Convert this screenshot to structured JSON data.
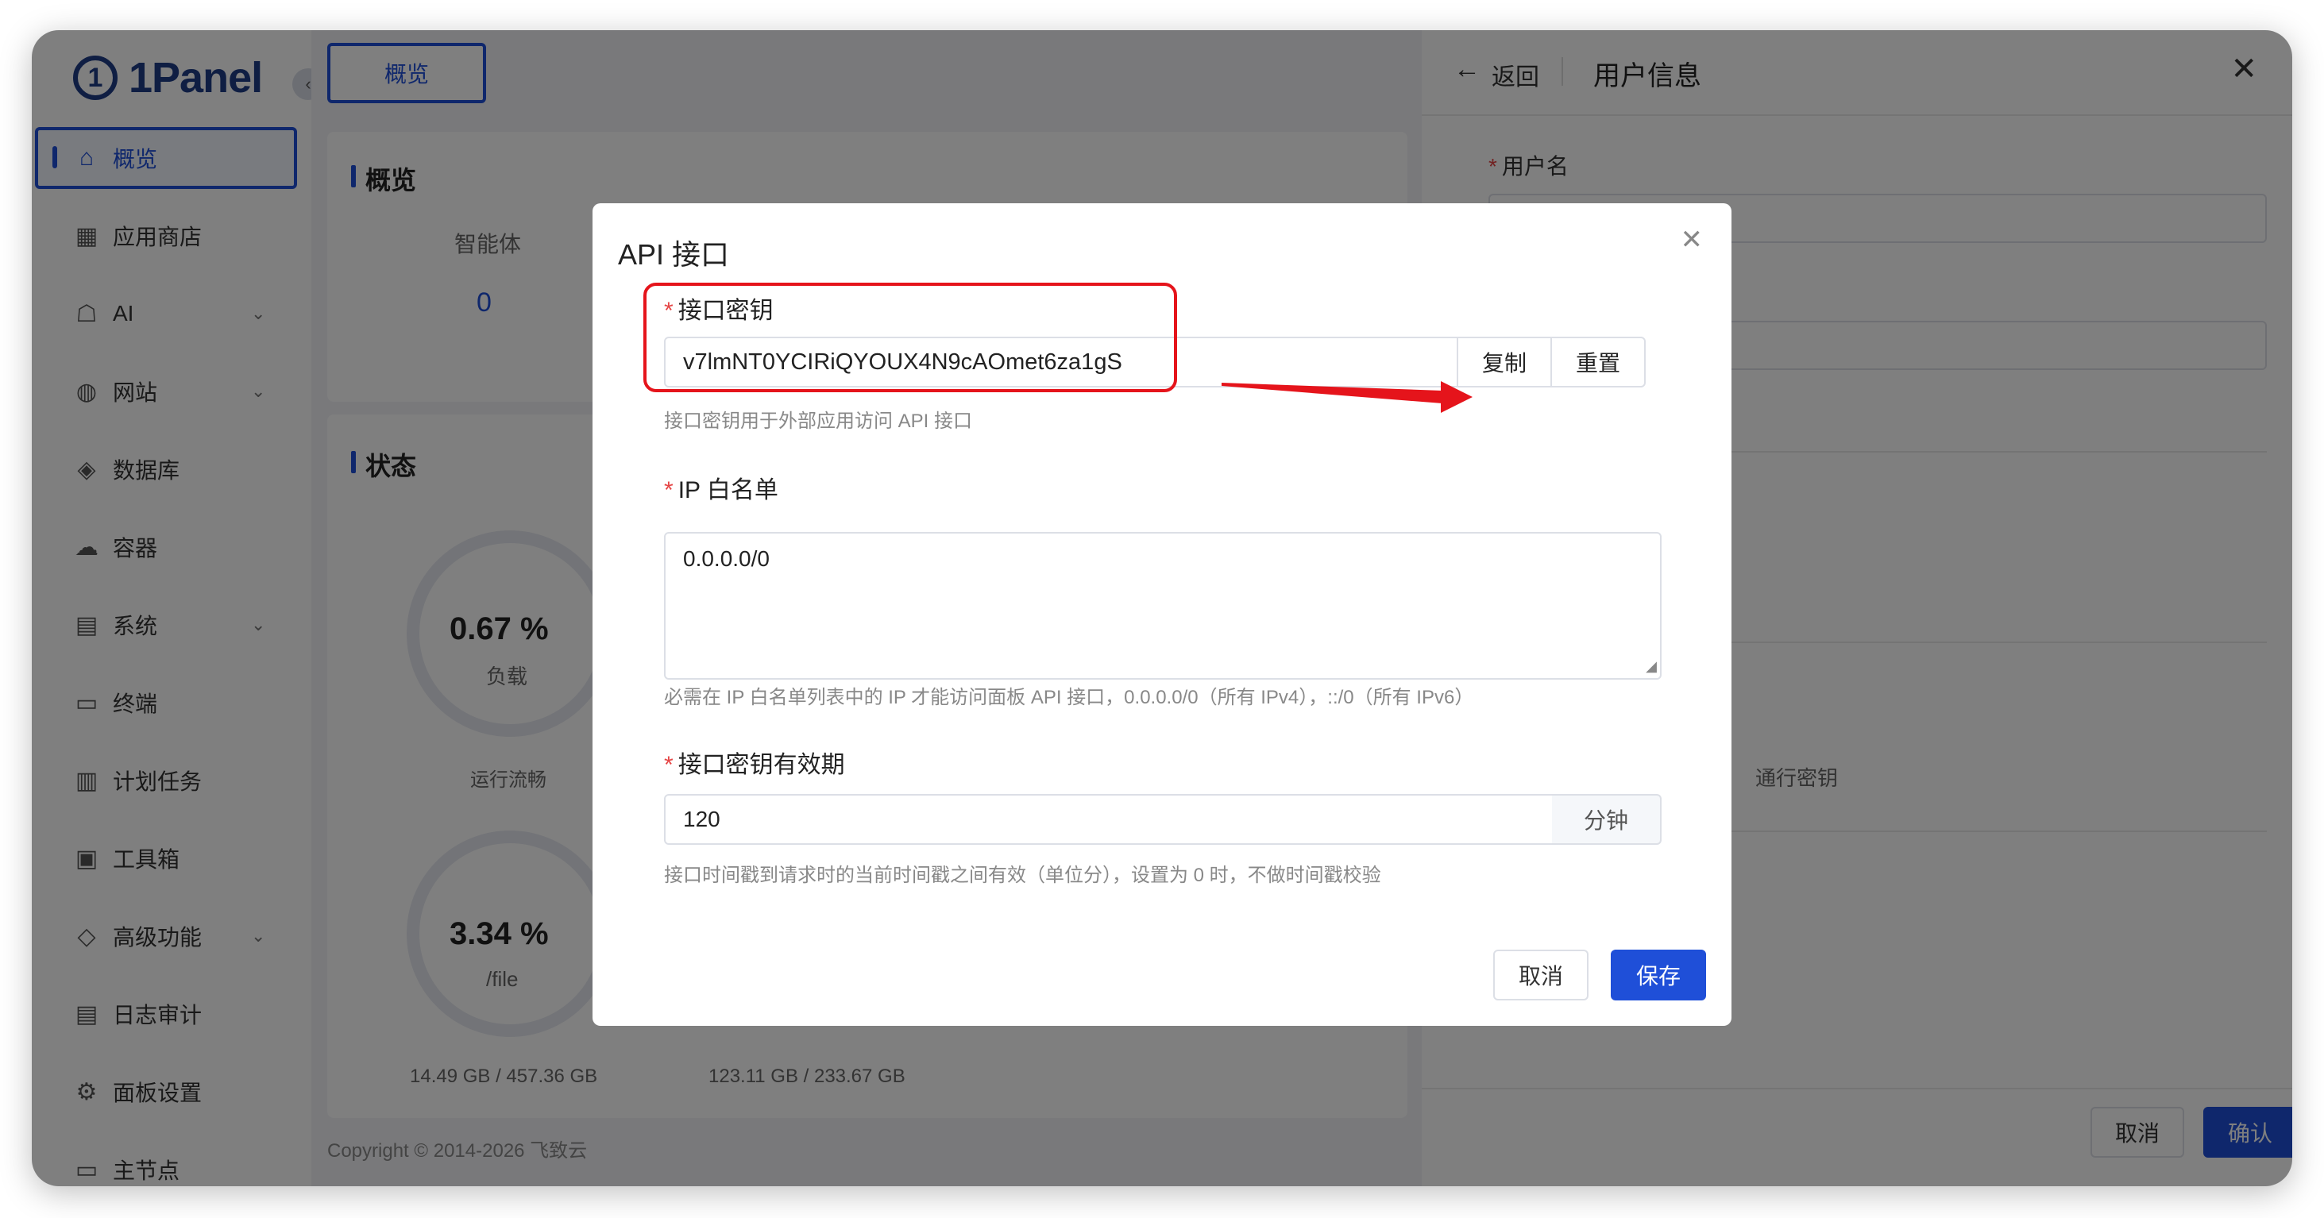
{
  "app": {
    "logo_mark": "1",
    "logo_text": "1Panel",
    "collapse_icon": "chevron-left-icon"
  },
  "sidebar": {
    "items": [
      {
        "label": "概览",
        "icon": "home-icon",
        "glyph": "⌂",
        "expandable": false,
        "active": true
      },
      {
        "label": "应用商店",
        "icon": "grid-icon",
        "glyph": "▦",
        "expandable": false
      },
      {
        "label": "AI",
        "icon": "robot-icon",
        "glyph": "☖",
        "expandable": true
      },
      {
        "label": "网站",
        "icon": "globe-icon",
        "glyph": "◍",
        "expandable": true
      },
      {
        "label": "数据库",
        "icon": "layers-icon",
        "glyph": "◈",
        "expandable": false
      },
      {
        "label": "容器",
        "icon": "docker-icon",
        "glyph": "☁",
        "expandable": false
      },
      {
        "label": "系统",
        "icon": "file-icon",
        "glyph": "▤",
        "expandable": true
      },
      {
        "label": "终端",
        "icon": "terminal-icon",
        "glyph": "▭",
        "expandable": false
      },
      {
        "label": "计划任务",
        "icon": "calendar-icon",
        "glyph": "▥",
        "expandable": false
      },
      {
        "label": "工具箱",
        "icon": "toolbox-icon",
        "glyph": "▣",
        "expandable": false
      },
      {
        "label": "高级功能",
        "icon": "diamond-icon",
        "glyph": "◇",
        "expandable": true
      },
      {
        "label": "日志审计",
        "icon": "log-icon",
        "glyph": "▤",
        "expandable": false
      },
      {
        "label": "面板设置",
        "icon": "gear-icon",
        "glyph": "⚙",
        "expandable": false
      },
      {
        "label": "主节点",
        "icon": "node-icon",
        "glyph": "▭",
        "expandable": false
      }
    ]
  },
  "main": {
    "tab": "概览",
    "overview_title": "概览",
    "agent_label": "智能体",
    "agent_value": "0",
    "status_title": "状态",
    "load_value": "0.67 %",
    "load_label": "负载",
    "run_label": "运行流畅",
    "disk_value": "3.34 %",
    "disk_label": "/file",
    "disk_usage_1": "14.49 GB / 457.36 GB",
    "disk_usage_2": "123.11 GB / 233.67 GB",
    "copyright": "Copyright © 2014-2026 飞致云"
  },
  "drawer": {
    "back_label": "返回",
    "title": "用户信息",
    "username_label": "用户名",
    "partial_text": "通行密钥",
    "cancel": "取消",
    "confirm": "确认"
  },
  "dialog": {
    "title": "API 接口",
    "key_label": "接口密钥",
    "key_value": "v7lmNT0YCIRiQYOUX4N9cAOmet6za1gS",
    "copy_btn": "复制",
    "reset_btn": "重置",
    "key_help": "接口密钥用于外部应用访问 API 接口",
    "whitelist_label": "IP 白名单",
    "whitelist_value": "0.0.0.0/0",
    "whitelist_help": "必需在 IP 白名单列表中的 IP 才能访问面板 API 接口，0.0.0.0/0（所有 IPv4），::/0（所有 IPv6）",
    "validity_label": "接口密钥有效期",
    "validity_value": "120",
    "validity_unit": "分钟",
    "validity_help": "接口时间戳到请求时的当前时间戳之间有效（单位分），设置为 0 时，不做时间戳校验",
    "cancel": "取消",
    "save": "保存"
  },
  "colors": {
    "primary": "#1f4fd8",
    "annotation_red": "#e5141b",
    "required": "#e54545"
  }
}
